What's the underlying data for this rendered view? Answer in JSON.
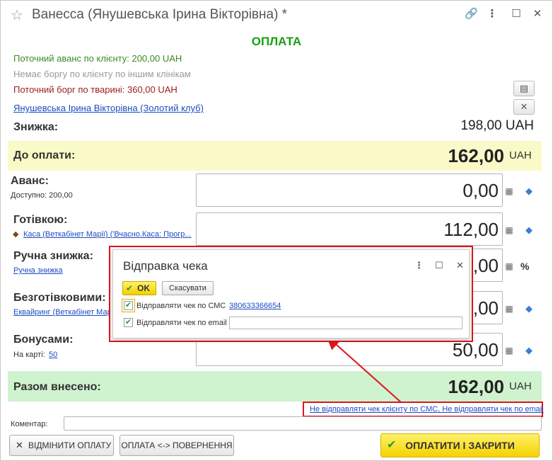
{
  "window": {
    "title": "Ванесса (Янушевська Ірина Вікторівна) *"
  },
  "header": {
    "title": "ОПЛАТА"
  },
  "info": {
    "advance_line": "Поточний аванс по клієнту: 200,00 UAH",
    "no_debt_line": "Немає боргу по клієнту по іншим клінікам",
    "pet_debt_line": "Поточний борг по тварині: 360,00 UAH",
    "client_link": "Янушевська Ірина Вікторівна (Золотий клуб)"
  },
  "discount": {
    "label": "Знижка:",
    "value": "198,00 UAH"
  },
  "to_pay": {
    "label": "До оплати:",
    "value": "162,00",
    "currency": "UAH"
  },
  "rows": [
    {
      "label": "Аванс:",
      "sub_label": "Доступно: 200,00",
      "sub_link": "",
      "value": "0,00",
      "suffix": ""
    },
    {
      "label": "Готівкою:",
      "sub_label": "",
      "sub_link": "Каса (Веткабінет Марії) ('Вчасно.Каса: Прогр...",
      "value": "112,00",
      "suffix": ""
    },
    {
      "label": "Ручна знижка:",
      "sub_label": "",
      "sub_link": "Ручна знижка",
      "value": ",00",
      "suffix": "%"
    },
    {
      "label": "Безготівковими:",
      "sub_label": "",
      "sub_link": "Еквайринг (Веткабінет Марії)...",
      "value": ",00",
      "suffix": ""
    },
    {
      "label": "Бонусами:",
      "sub_label": "На карті:",
      "sub_link": "50",
      "value": "50,00",
      "suffix": ""
    }
  ],
  "total": {
    "label": "Разом внесено:",
    "value": "162,00",
    "currency": "UAH"
  },
  "receipt_status_link": "Не відправляти чек клієнту по СМС, Не відправляти чек по email",
  "comment": {
    "label": "Коментар:",
    "value": ""
  },
  "buttons": {
    "cancel_payment": "ВІДМІНИТИ ОПЛАТУ",
    "payment_return": "ОПЛАТА <-> ПОВЕРНЕННЯ",
    "pay_close": "ОПЛАТИТИ І ЗАКРИТИ"
  },
  "dialog": {
    "title": "Відправка чека",
    "ok_label": "OK",
    "cancel_label": "Скасувати",
    "sms_label": "Відправляти чек по СМС",
    "sms_phone": "380633366654",
    "sms_checked": true,
    "email_label": "Відправляти чек по email",
    "email_checked": true,
    "email_value": ""
  },
  "colors": {
    "accent_green": "#15a011",
    "link_blue": "#1a4cc4",
    "highlight_red": "#e0141e",
    "yellow_band": "#fafac8",
    "green_band": "#cff2cf",
    "primary_button": "#f5d200"
  }
}
